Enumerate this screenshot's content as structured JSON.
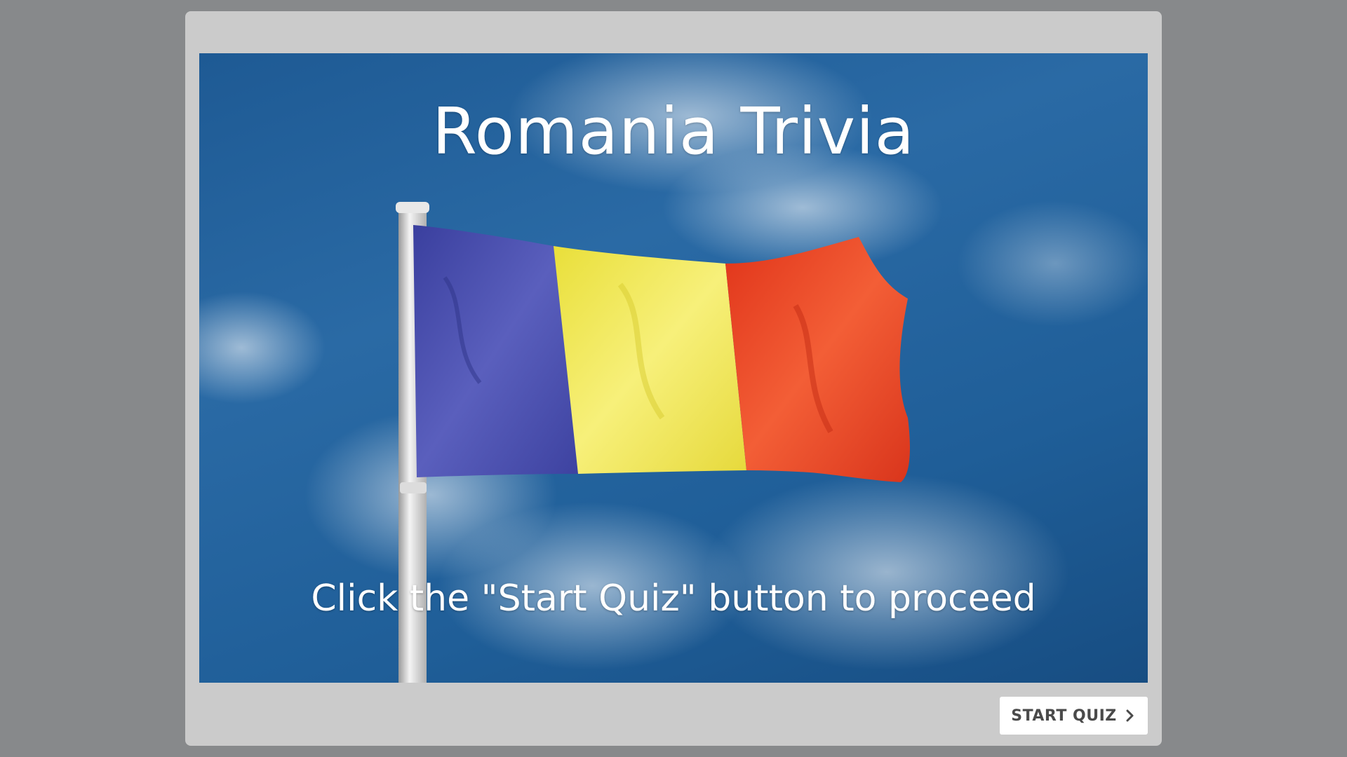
{
  "quiz": {
    "title": "Romania Trivia",
    "subtitle": "Click the \"Start Quiz\" button to proceed",
    "start_button_label": "START QUIZ",
    "start_button_icon": "chevron-right-icon"
  },
  "flag": {
    "country": "Romania",
    "colors": [
      "#4a4fa8",
      "#f2e84a",
      "#ef4a26"
    ]
  },
  "colors": {
    "page_background": "#87898b",
    "frame_background": "#cbcbcb",
    "sky": "#2366a2",
    "button_text": "#4a4a4a"
  }
}
